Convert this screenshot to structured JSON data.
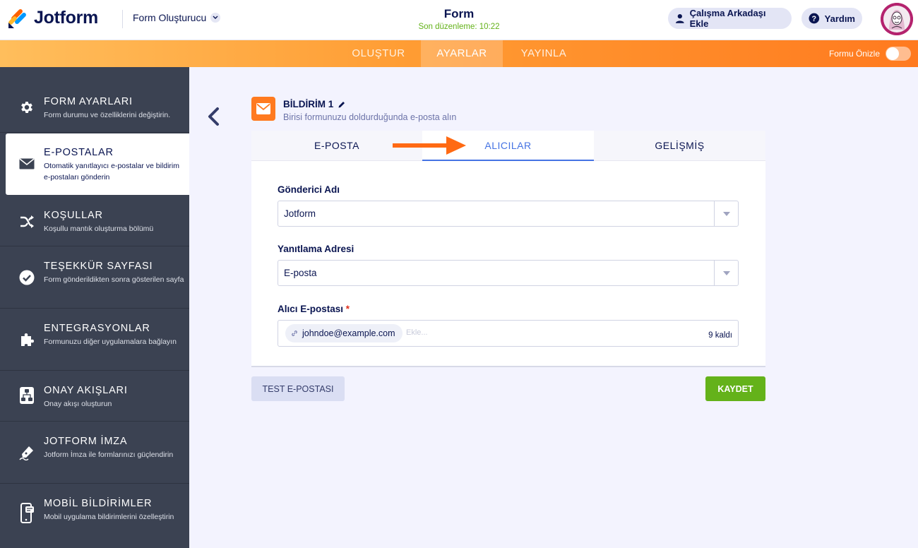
{
  "header": {
    "logo_text": "Jotform",
    "builder_menu": "Form Oluşturucu",
    "form_title": "Form",
    "last_edit": "Son düzenleme: 10:22",
    "collab_label": "Çalışma Arkadaşı Ekle",
    "help_label": "Yardım"
  },
  "navbar": {
    "tabs": [
      "OLUŞTUR",
      "AYARLAR",
      "YAYINLA"
    ],
    "active_tab": "AYARLAR",
    "preview_label": "Formu Önizle",
    "preview_enabled": false
  },
  "sidebar": {
    "items": [
      {
        "title": "FORM AYARLARI",
        "desc": "Form durumu ve özelliklerini değiştirin.",
        "icon": "gear-icon"
      },
      {
        "title": "E-POSTALAR",
        "desc": "Otomatik yanıtlayıcı e-postalar ve bildirim e-postaları gönderin",
        "icon": "envelope-icon"
      },
      {
        "title": "KOŞULLAR",
        "desc": "Koşullu mantık oluşturma bölümü",
        "icon": "shuffle-icon"
      },
      {
        "title": "TEŞEKKÜR SAYFASI",
        "desc": "Form gönderildikten sonra gösterilen sayfa",
        "icon": "check-circle-icon"
      },
      {
        "title": "ENTEGRASYONLAR",
        "desc": "Formunuzu diğer uygulamalara bağlayın",
        "icon": "puzzle-icon"
      },
      {
        "title": "ONAY AKIŞLARI",
        "desc": "Onay akışı oluşturun",
        "icon": "approval-flow-icon"
      },
      {
        "title": "JOTFORM İMZA",
        "desc": "Jotform İmza ile formlarınızı güçlendirin",
        "icon": "signature-pen-icon"
      },
      {
        "title": "MOBİL BİLDİRİMLER",
        "desc": "Mobil uygulama bildirimlerini özelleştirin",
        "icon": "mobile-notification-icon"
      }
    ],
    "active_index": 1
  },
  "notification": {
    "title": "BİLDİRİM 1",
    "subtitle": "Birisi formunuzu doldurduğunda e-posta alın"
  },
  "tabs": {
    "items": [
      "E-POSTA",
      "ALICILAR",
      "GELİŞMİŞ"
    ],
    "active": "ALICILAR"
  },
  "fields": {
    "sender_name_label": "Gönderici Adı",
    "sender_name_value": "Jotform",
    "reply_to_label": "Yanıtlama Adresi",
    "reply_to_value": "E-posta",
    "recipient_label": "Alıcı E-postası",
    "required_mark": "*",
    "recipient_tag": "johndoe@example.com",
    "add_placeholder": "Ekle...",
    "remaining": "9 kaldı"
  },
  "buttons": {
    "test_email": "TEST E-POSTASI",
    "save": "KAYDET"
  },
  "colors": {
    "brand_orange": "#ff7a1f",
    "active_tab_blue": "#4573e3",
    "save_green": "#64b21a",
    "sidebar_bg": "#3b4252"
  }
}
